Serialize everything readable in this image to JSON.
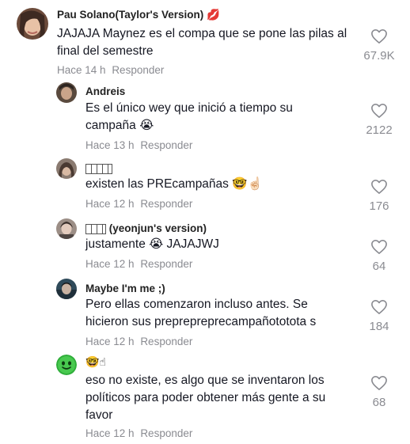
{
  "colors": {
    "text": "#161823",
    "meta": "#8a8b91",
    "heart": "#8a8b91",
    "lips": "#e8174a"
  },
  "comments": [
    {
      "username": "Pau Solano(Taylor's Version)",
      "username_emoji": "💋",
      "text": "JAJAJA Maynez es el compa que se pone las pilas al final del semestre",
      "time": "Hace 14 h",
      "reply": "Responder",
      "likes": "67.9K",
      "avatar_icon": "profile-photo-icon"
    },
    {
      "username": "Andreis",
      "text": "Es el único wey que inició a tiempo su campaña 😭",
      "time": "Hace 13 h",
      "reply": "Responder",
      "likes": "2122",
      "avatar_icon": "profile-photo-icon"
    },
    {
      "username": "",
      "text": "existen las PREcampañas 🤓☝🏻",
      "time": "Hace 12 h",
      "reply": "Responder",
      "likes": "176",
      "avatar_icon": "profile-photo-icon"
    },
    {
      "username": "(yeonjun's version)",
      "text": "justamente 😭 JAJAJWJ",
      "time": "Hace 12 h",
      "reply": "Responder",
      "likes": "64",
      "avatar_icon": "profile-photo-icon"
    },
    {
      "username": "Maybe I'm me ;)",
      "text": "Pero ellas comenzaron incluso antes. Se hicieron sus preprepreprecampañototota s",
      "time": "Hace 12 h",
      "reply": "Responder",
      "likes": "184",
      "avatar_icon": "profile-photo-icon"
    },
    {
      "username": "🤓☝",
      "text": "eso no existe, es algo que se inventaron los políticos para poder obtener más gente a su favor",
      "time": "Hace 12 h",
      "reply": "Responder",
      "likes": "68",
      "avatar_icon": "green-smiley-avatar-icon"
    }
  ]
}
